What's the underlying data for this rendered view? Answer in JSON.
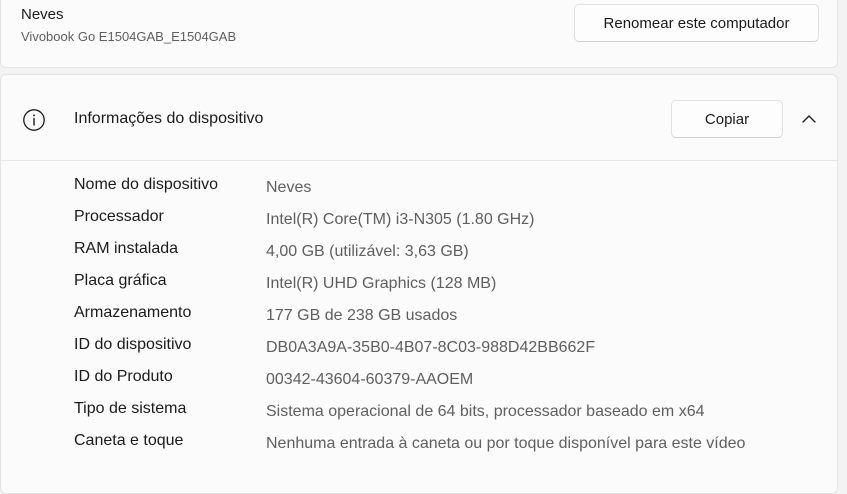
{
  "device": {
    "name": "Neves",
    "model": "Vivobook Go E1504GAB_E1504GAB",
    "rename_label": "Renomear este computador"
  },
  "info": {
    "title": "Informações do dispositivo",
    "copy_label": "Copiar",
    "specs": [
      {
        "label": "Nome do dispositivo",
        "value": "Neves"
      },
      {
        "label": "Processador",
        "value": "Intel(R) Core(TM) i3-N305 (1.80 GHz)"
      },
      {
        "label": "RAM instalada",
        "value": "4,00 GB (utilizável: 3,63 GB)"
      },
      {
        "label": "Placa gráfica",
        "value": "Intel(R) UHD Graphics (128 MB)"
      },
      {
        "label": "Armazenamento",
        "value": "177 GB de 238 GB usados"
      },
      {
        "label": "ID do dispositivo",
        "value": "DB0A3A9A-35B0-4B07-8C03-988D42BB662F"
      },
      {
        "label": "ID do Produto",
        "value": "00342-43604-60379-AAOEM"
      },
      {
        "label": "Tipo de sistema",
        "value": "Sistema operacional de 64 bits, processador baseado em x64"
      },
      {
        "label": "Caneta e toque",
        "value": "Nenhuma entrada à caneta ou por toque disponível para este vídeo"
      }
    ]
  },
  "icons": {
    "info": "info-circle-icon",
    "collapse": "chevron-up-icon"
  }
}
